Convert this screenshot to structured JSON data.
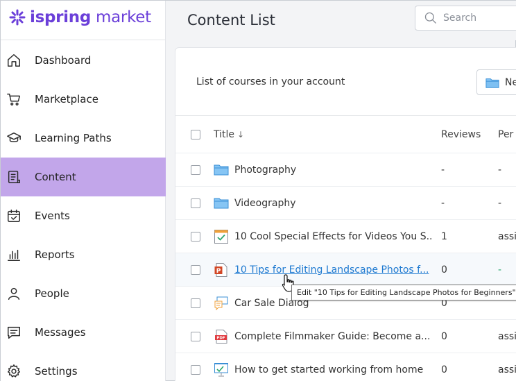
{
  "app": {
    "brand_bold": "ispring",
    "brand_regular": " market",
    "brand_color": "#6b3fd9",
    "accent_active": "#c2a6ea"
  },
  "sidebar": {
    "items": [
      {
        "label": "Dashboard",
        "icon": "home-icon",
        "active": false
      },
      {
        "label": "Marketplace",
        "icon": "cart-icon",
        "active": false
      },
      {
        "label": "Learning Paths",
        "icon": "graduation-cap-icon",
        "active": false
      },
      {
        "label": "Content",
        "icon": "document-icon",
        "active": true
      },
      {
        "label": "Events",
        "icon": "calendar-check-icon",
        "active": false
      },
      {
        "label": "Reports",
        "icon": "bar-chart-icon",
        "active": false
      },
      {
        "label": "People",
        "icon": "person-icon",
        "active": false
      },
      {
        "label": "Messages",
        "icon": "message-icon",
        "active": false
      },
      {
        "label": "Settings",
        "icon": "gear-icon",
        "active": false
      }
    ]
  },
  "header": {
    "title": "Content List",
    "search_placeholder": "Search"
  },
  "panel": {
    "subtitle": "List of courses in your account",
    "new_button": "Ne"
  },
  "table": {
    "columns": {
      "title": "Title",
      "sort_glyph": "↓",
      "reviews": "Reviews",
      "permissions": "Per"
    },
    "rows": [
      {
        "type": "folder",
        "title": "Photography",
        "reviews": "-",
        "permissions": "-"
      },
      {
        "type": "folder",
        "title": "Videography",
        "reviews": "-",
        "permissions": "-"
      },
      {
        "type": "quiz",
        "title": "10 Cool Special Effects for Videos You S...",
        "reviews": "1",
        "permissions": "assi"
      },
      {
        "type": "ppt",
        "title": "10 Tips for Editing Landscape Photos f...",
        "reviews": "0",
        "permissions": "-"
      },
      {
        "type": "dialog",
        "title": "Car Sale Dialog",
        "reviews": "0",
        "permissions": ""
      },
      {
        "type": "pdf",
        "title": "Complete Filmmaker Guide: Become a...",
        "reviews": "0",
        "permissions": "assi"
      },
      {
        "type": "presentation",
        "title": "How to get started working from home",
        "reviews": "0",
        "permissions": "assi"
      }
    ]
  },
  "tooltip": {
    "text": "Edit \"10 Tips for Editing Landscape Photos for Beginners\""
  }
}
